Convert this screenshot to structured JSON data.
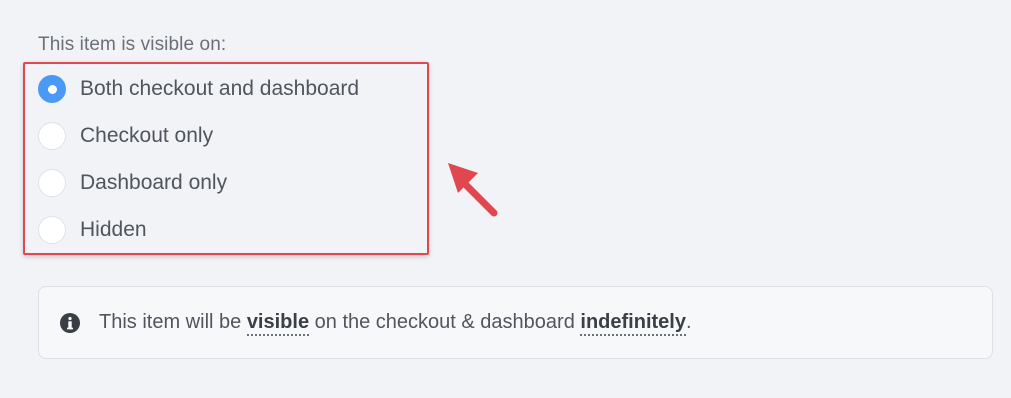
{
  "visibility": {
    "label": "This item is visible on:",
    "options": [
      {
        "label": "Both checkout and dashboard",
        "checked": true
      },
      {
        "label": "Checkout only",
        "checked": false
      },
      {
        "label": "Dashboard only",
        "checked": false
      },
      {
        "label": "Hidden",
        "checked": false
      }
    ]
  },
  "info": {
    "icon": "info-icon",
    "text_before": "This item will be ",
    "emph1": "visible",
    "text_middle": " on the checkout & dashboard ",
    "emph2": "indefinitely",
    "text_after": "."
  },
  "colors": {
    "accent": "#4a9af5",
    "annotation": "#e0474f"
  }
}
